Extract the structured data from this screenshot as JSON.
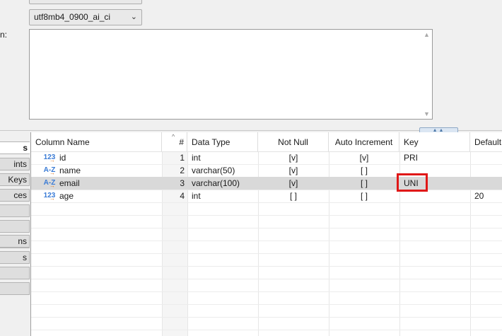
{
  "properties": {
    "charset_value": "utf8mb4",
    "collation_value": "utf8mb4_0900_ai_ci",
    "description_label": "n:",
    "description_value": ""
  },
  "side_tabs": [
    {
      "label": "s",
      "active": true
    },
    {
      "label": "ints",
      "active": false
    },
    {
      "label": "Keys",
      "active": false
    },
    {
      "label": "ces",
      "active": false
    },
    {
      "label": "",
      "active": false
    },
    {
      "label": "",
      "active": false
    },
    {
      "label": "",
      "active": false
    },
    {
      "label": "ns",
      "active": false
    },
    {
      "label": "s",
      "active": false
    },
    {
      "label": "",
      "active": false
    },
    {
      "label": "",
      "active": false
    }
  ],
  "grid": {
    "headers": {
      "column_name": "Column Name",
      "num": "#",
      "data_type": "Data Type",
      "not_null": "Not Null",
      "auto_increment": "Auto Increment",
      "key": "Key",
      "default": "Default"
    },
    "rows": [
      {
        "icon": "numeric-type-icon",
        "icon_text": "123",
        "name": "id",
        "num": "1",
        "type": "int",
        "not_null": "[v]",
        "auto_inc": "[v]",
        "key": "PRI",
        "default": ""
      },
      {
        "icon": "string-type-icon",
        "icon_text": "A-Z",
        "name": "name",
        "num": "2",
        "type": "varchar(50)",
        "not_null": "[v]",
        "auto_inc": "[ ]",
        "key": "",
        "default": ""
      },
      {
        "icon": "string-type-icon",
        "icon_text": "A-Z",
        "name": "email",
        "num": "3",
        "type": "varchar(100)",
        "not_null": "[v]",
        "auto_inc": "[ ]",
        "key": "UNI",
        "default": ""
      },
      {
        "icon": "numeric-type-icon",
        "icon_text": "123",
        "name": "age",
        "num": "4",
        "type": "int",
        "not_null": "[ ]",
        "auto_inc": "[ ]",
        "key": "",
        "default": "20"
      }
    ],
    "selected_row": 3
  },
  "colors": {
    "highlight": "#e01818",
    "selected_row": "#d9d9d9",
    "type_icon": "#3a7bd5"
  }
}
